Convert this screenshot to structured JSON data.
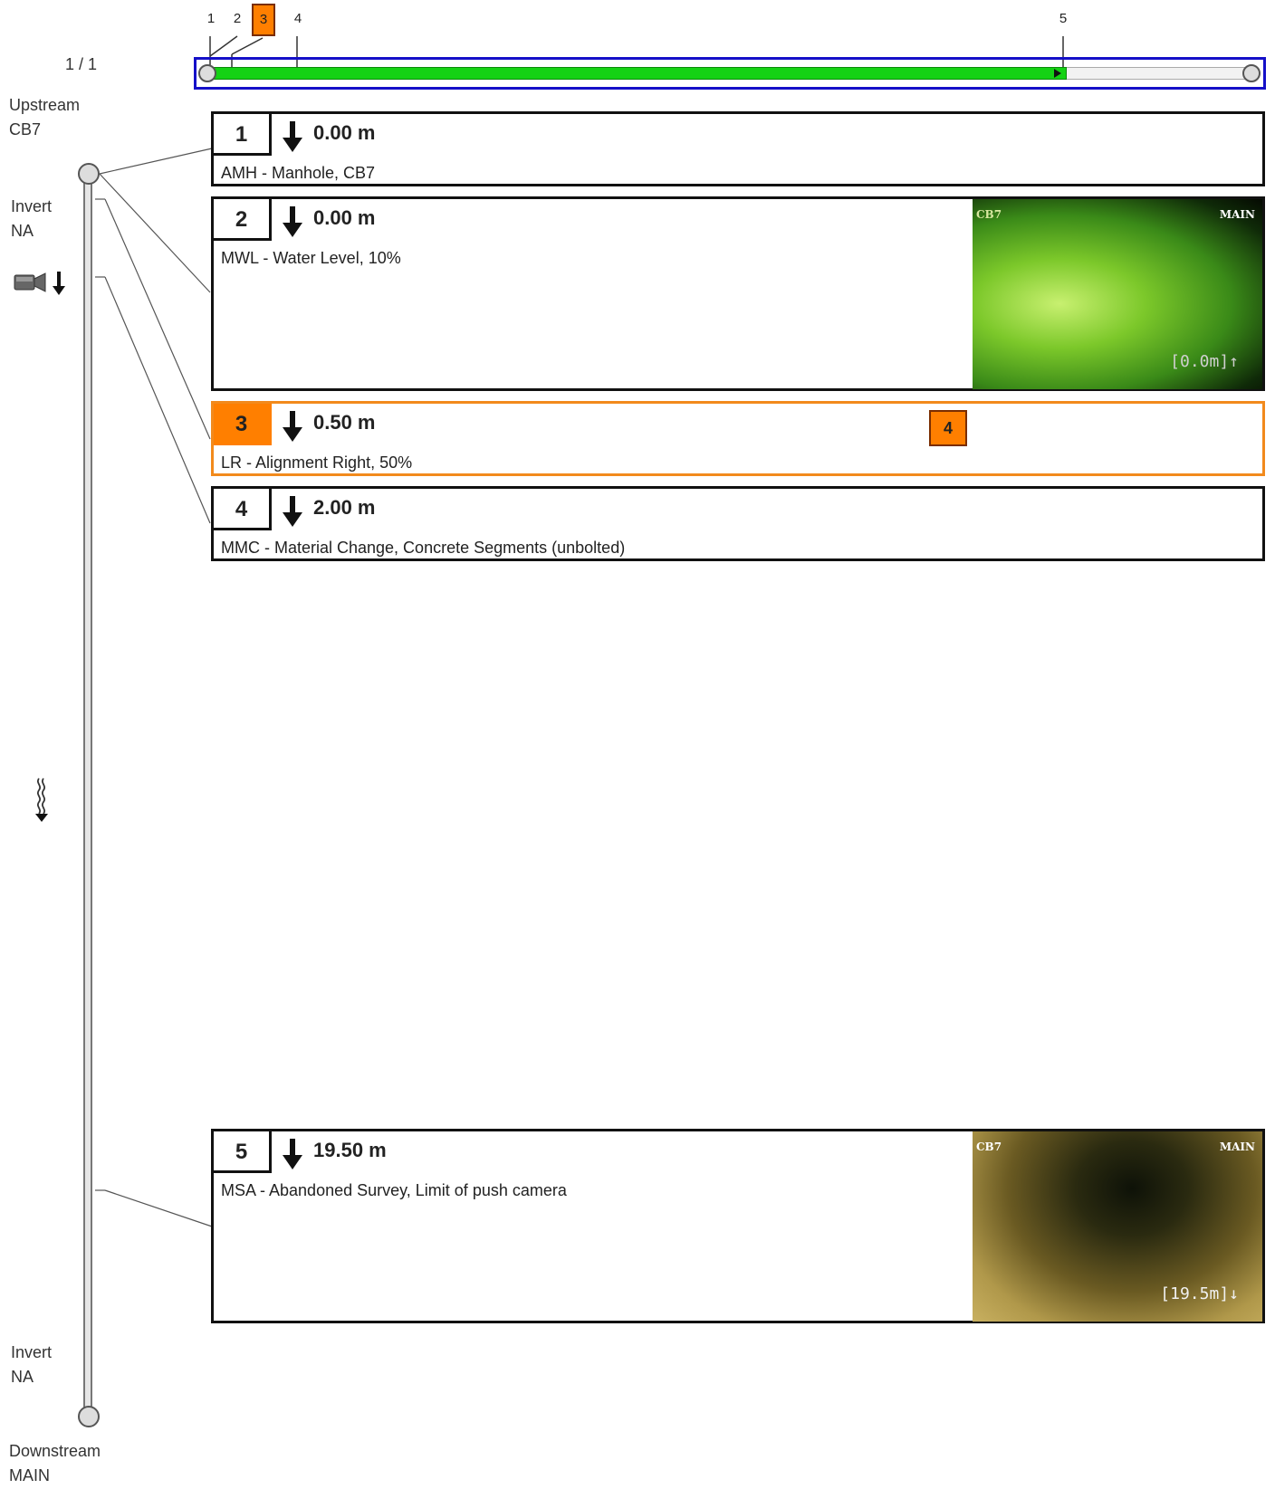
{
  "page_counter": "1 / 1",
  "upstream": {
    "label": "Upstream",
    "value": "CB7"
  },
  "downstream": {
    "label": "Downstream",
    "value": "MAIN"
  },
  "invert_top": {
    "label": "Invert",
    "value": "NA"
  },
  "invert_bottom": {
    "label": "Invert",
    "value": "NA"
  },
  "timeline": {
    "ticks": [
      "1",
      "2",
      "3",
      "4",
      "5"
    ],
    "active_tick": "3",
    "progress_fraction": 0.82
  },
  "icons": {
    "camera_direction": "camera-down-icon",
    "flow_direction": "flow-down-icon"
  },
  "observations": [
    {
      "num": "1",
      "distance": "0.00 m",
      "description": "AMH - Manhole, CB7",
      "direction": "down",
      "selected": false
    },
    {
      "num": "2",
      "distance": "0.00 m",
      "description": "MWL - Water Level, 10%",
      "direction": "down",
      "selected": false,
      "thumbnail": {
        "start": "CB7",
        "finish": "MAIN",
        "reading": "[0.0m]↑"
      }
    },
    {
      "num": "3",
      "distance": "0.50 m",
      "description": "LR - Alignment Right, 50%",
      "direction": "down",
      "selected": true,
      "badge": "4"
    },
    {
      "num": "4",
      "distance": "2.00 m",
      "description": "MMC - Material Change, Concrete Segments (unbolted)",
      "direction": "down",
      "selected": false
    },
    {
      "num": "5",
      "distance": "19.50 m",
      "description": "MSA - Abandoned Survey, Limit of push camera",
      "direction": "down",
      "selected": false,
      "thumbnail": {
        "start": "CB7",
        "finish": "MAIN",
        "reading": "[19.5m]↓"
      }
    }
  ],
  "colors": {
    "selection": "#ff7f00",
    "progress": "#14d214",
    "frame": "#1510c8"
  }
}
